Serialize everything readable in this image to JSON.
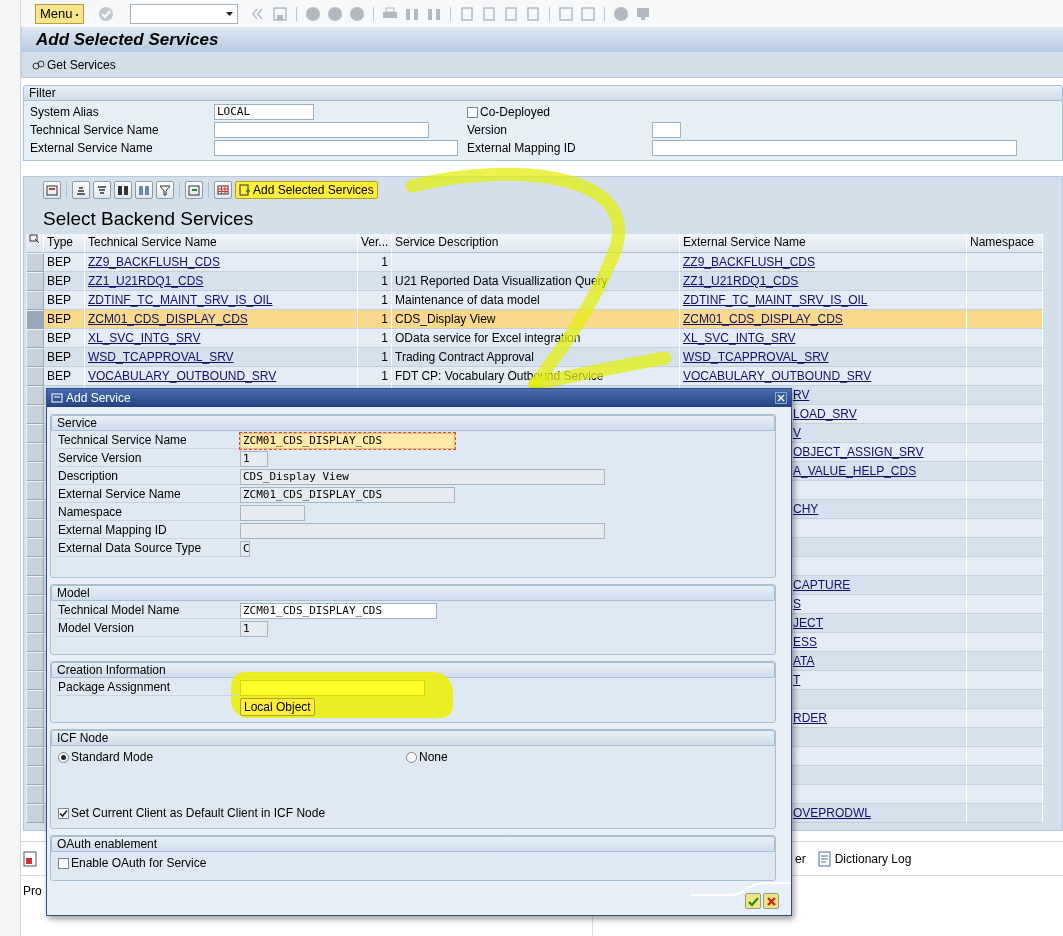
{
  "toolbar": {
    "menu": "Menu"
  },
  "title": "Add Selected Services",
  "app_toolbar": [
    {
      "label": "Get Services"
    }
  ],
  "filter": {
    "title": "Filter",
    "fields": [
      {
        "kind": "field",
        "label": "System Alias",
        "value": "LOCAL"
      },
      {
        "kind": "checkbox",
        "label": "Co-Deployed",
        "checked": false
      },
      {
        "kind": "field",
        "label": "Technical Service Name"
      },
      {
        "kind": "field",
        "label": "Version"
      },
      {
        "kind": "field",
        "label": "External Service Name"
      },
      {
        "kind": "field",
        "label": "External Mapping ID"
      }
    ]
  },
  "table": {
    "action": "Add Selected Services",
    "title": "Select Backend Services",
    "columns": [
      "Type",
      "Technical Service Name",
      "Ver...",
      "Service Description",
      "External Service Name",
      "Namespace"
    ],
    "rows": [
      {
        "kind": "full",
        "type": "BEP",
        "technical": "ZZ9_BACKFLUSH_CDS",
        "version": "1",
        "external": "ZZ9_BACKFLUSH_CDS",
        "selected": false
      },
      {
        "kind": "full",
        "type": "BEP",
        "technical": "ZZ1_U21RDQ1_CDS",
        "version": "1",
        "description": "U21 Reported Data Visuallization Query",
        "external": "ZZ1_U21RDQ1_CDS",
        "selected": false
      },
      {
        "kind": "full",
        "type": "BEP",
        "technical": "ZDTINF_TC_MAINT_SRV_IS_OIL",
        "version": "1",
        "description": "Maintenance of data model",
        "external": "ZDTINF_TC_MAINT_SRV_IS_OIL",
        "selected": false
      },
      {
        "kind": "full",
        "type": "BEP",
        "technical": "ZCM01_CDS_DISPLAY_CDS",
        "version": "1",
        "description": "CDS_Display View",
        "external": "ZCM01_CDS_DISPLAY_CDS",
        "selected": true
      },
      {
        "kind": "full",
        "type": "BEP",
        "technical": "XL_SVC_INTG_SRV",
        "version": "1",
        "description": "OData service for Excel integration",
        "external": "XL_SVC_INTG_SRV",
        "selected": false
      },
      {
        "kind": "full",
        "type": "BEP",
        "technical": "WSD_TCAPPROVAL_SRV",
        "version": "1",
        "description": "Trading Contract Approval",
        "external": "WSD_TCAPPROVAL_SRV",
        "selected": false
      },
      {
        "kind": "full",
        "type": "BEP",
        "technical": "VOCABULARY_OUTBOUND_SRV",
        "version": "1",
        "description": "FDT CP: Vocabulary Outbound Service",
        "external": "VOCABULARY_OUTBOUND_SRV",
        "selected": false
      },
      {
        "kind": "partial",
        "external": "RV",
        "selected": false
      },
      {
        "kind": "partial",
        "external": "LOAD_SRV",
        "selected": false
      },
      {
        "kind": "partial",
        "external": "V",
        "selected": false
      },
      {
        "kind": "partial",
        "external": "OBJECT_ASSIGN_SRV",
        "selected": false
      },
      {
        "kind": "partial",
        "external": "A_VALUE_HELP_CDS",
        "selected": false
      },
      {
        "kind": "partial",
        "selected": false
      },
      {
        "kind": "partial",
        "external": "CHY",
        "selected": false
      },
      {
        "kind": "partial",
        "selected": false
      },
      {
        "kind": "partial",
        "selected": false
      },
      {
        "kind": "partial",
        "selected": false
      },
      {
        "kind": "partial",
        "external": "CAPTURE",
        "selected": false
      },
      {
        "kind": "partial",
        "external": "S",
        "selected": false
      },
      {
        "kind": "partial",
        "external": "JECT",
        "selected": false
      },
      {
        "kind": "partial",
        "external": "ESS",
        "selected": false
      },
      {
        "kind": "partial",
        "external": "ATA",
        "selected": false
      },
      {
        "kind": "partial",
        "external": "T",
        "selected": false
      },
      {
        "kind": "partial",
        "selected": false
      },
      {
        "kind": "partial",
        "external": "RDER",
        "selected": false
      },
      {
        "kind": "partial",
        "selected": false
      },
      {
        "kind": "partial",
        "selected": false
      },
      {
        "kind": "partial",
        "selected": false
      },
      {
        "kind": "partial",
        "selected": false
      },
      {
        "kind": "partial",
        "external": "OVEPRODWL",
        "selected": false
      }
    ]
  },
  "bottom_panel": {
    "tabs": [
      {
        "label": "er"
      },
      {
        "label": "Dictionary Log"
      }
    ],
    "text": "Pro"
  },
  "dialog": {
    "title": "Add Service",
    "groups": [
      {
        "kind": "fields",
        "title": "Service",
        "fields": [
          {
            "label": "Technical Service Name",
            "value": "ZCM01_CDS_DISPLAY_CDS",
            "editable": true,
            "focused": true
          },
          {
            "label": "Service Version",
            "value": "1",
            "editable": false,
            "focused": false
          },
          {
            "label": "Description",
            "value": "CDS_Display View",
            "editable": false,
            "focused": false
          },
          {
            "label": "External Service Name",
            "value": "ZCM01_CDS_DISPLAY_CDS",
            "editable": false,
            "focused": false
          },
          {
            "label": "Namespace",
            "editable": false,
            "focused": false
          },
          {
            "label": "External Mapping ID",
            "editable": false,
            "focused": false
          },
          {
            "label": "External Data Source Type",
            "value": "C",
            "editable": false,
            "focused": false
          }
        ]
      },
      {
        "kind": "fields",
        "title": "Model",
        "fields": [
          {
            "label": "Technical Model Name",
            "value": "ZCM01_CDS_DISPLAY_CDS",
            "editable": true,
            "focused": false
          },
          {
            "label": "Model Version",
            "value": "1",
            "editable": false,
            "focused": false
          }
        ]
      },
      {
        "kind": "fields",
        "title": "Creation Information",
        "highlighted": true,
        "fields": [
          {
            "label": "Package Assignment",
            "editable": true,
            "focused": false
          }
        ],
        "button": "Local Object"
      },
      {
        "kind": "options",
        "title": "ICF Node",
        "radios": [
          {
            "label": "Standard Mode",
            "selected": true
          },
          {
            "label": "None",
            "selected": false
          }
        ],
        "checkboxes": [
          {
            "label": "Set Current Client as Default Client in ICF Node",
            "checked": true
          }
        ]
      },
      {
        "kind": "options",
        "title": "OAuth enablement",
        "checkboxes": [
          {
            "label": "Enable OAuth for Service",
            "checked": false
          }
        ]
      }
    ]
  }
}
